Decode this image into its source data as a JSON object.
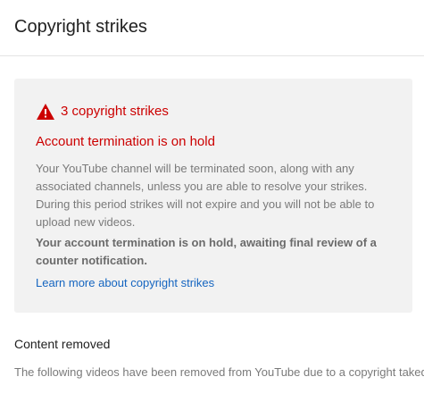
{
  "header": {
    "title": "Copyright strikes"
  },
  "strike_card": {
    "icon": "warning-triangle-icon",
    "strike_count_label": "3 copyright strikes",
    "termination_heading": "Account termination is on hold",
    "termination_body_lines": [
      "Your YouTube channel will be terminated soon, along with any",
      "associated channels, unless you are able to resolve your strikes.",
      "During this period strikes will not expire and you will not be able to",
      "upload new videos."
    ],
    "hold_note_lines": [
      "Your account termination is on hold, awaiting final review of a",
      "counter notification."
    ],
    "learn_more_link": "Learn more about copyright strikes"
  },
  "content_removed": {
    "heading": "Content removed",
    "body": "The following videos have been removed from YouTube due to a copyright takedown"
  },
  "colors": {
    "alert_red": "#cc0000",
    "link_blue": "#1565c0",
    "card_background": "#f2f2f2"
  }
}
